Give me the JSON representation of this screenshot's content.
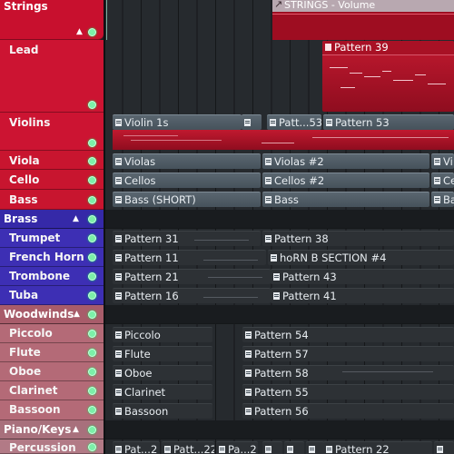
{
  "groups": {
    "strings": {
      "label": "Strings",
      "color": "#c8102e"
    },
    "brass": {
      "label": "Brass",
      "color": "#3529a8"
    },
    "woodwinds": {
      "label": "Woodwinds",
      "color": "#b06070"
    },
    "piano_keys": {
      "label": "Piano/Keys",
      "color": "#a8707c"
    }
  },
  "tracks": {
    "lead": "Lead",
    "violins": "Violins",
    "viola": "Viola",
    "cello": "Cello",
    "bass": "Bass",
    "trumpet": "Trumpet",
    "french_horn": "French Horn",
    "trombone": "Trombone",
    "tuba": "Tuba",
    "piccolo": "Piccolo",
    "flute": "Flute",
    "oboe": "Oboe",
    "clarinet": "Clarinet",
    "bassoon": "Bassoon",
    "percussion": "Percussion"
  },
  "clips": {
    "automation": "STRINGS - Volume",
    "lead_p39": "Pattern 39",
    "violins_1s": "Violin 1s",
    "violins_p53a": "Patt...53",
    "violins_p53b": "Pattern 53",
    "viola_a": "Violas",
    "viola_b": "Violas #2",
    "viola_c": "Vi",
    "cello_a": "Cellos",
    "cello_b": "Cellos #2",
    "cello_c": "Ce",
    "bass_a": "Bass (SHORT)",
    "bass_b": "Bass",
    "bass_c": "Ba",
    "trumpet_a": "Pattern 31",
    "trumpet_b": "Pattern 38",
    "horn_a": "Pattern 11",
    "horn_b": "hoRN B SECTION #4",
    "trombone_a": "Pattern 21",
    "trombone_b": "Pattern 43",
    "tuba_a": "Pattern 16",
    "tuba_b": "Pattern 41",
    "piccolo_a": "Piccolo",
    "piccolo_b": "Pattern 54",
    "flute_a": "Flute",
    "flute_b": "Pattern 57",
    "oboe_a": "Oboe",
    "oboe_b": "Pattern 58",
    "clarinet_a": "Clarinet",
    "clarinet_b": "Pattern 55",
    "bassoon_a": "Bassoon",
    "bassoon_b": "Pattern 56",
    "perc_a": "Pat...2",
    "perc_b": "Patt...22",
    "perc_c": "Pa...2",
    "perc_d": "Pattern 22"
  }
}
